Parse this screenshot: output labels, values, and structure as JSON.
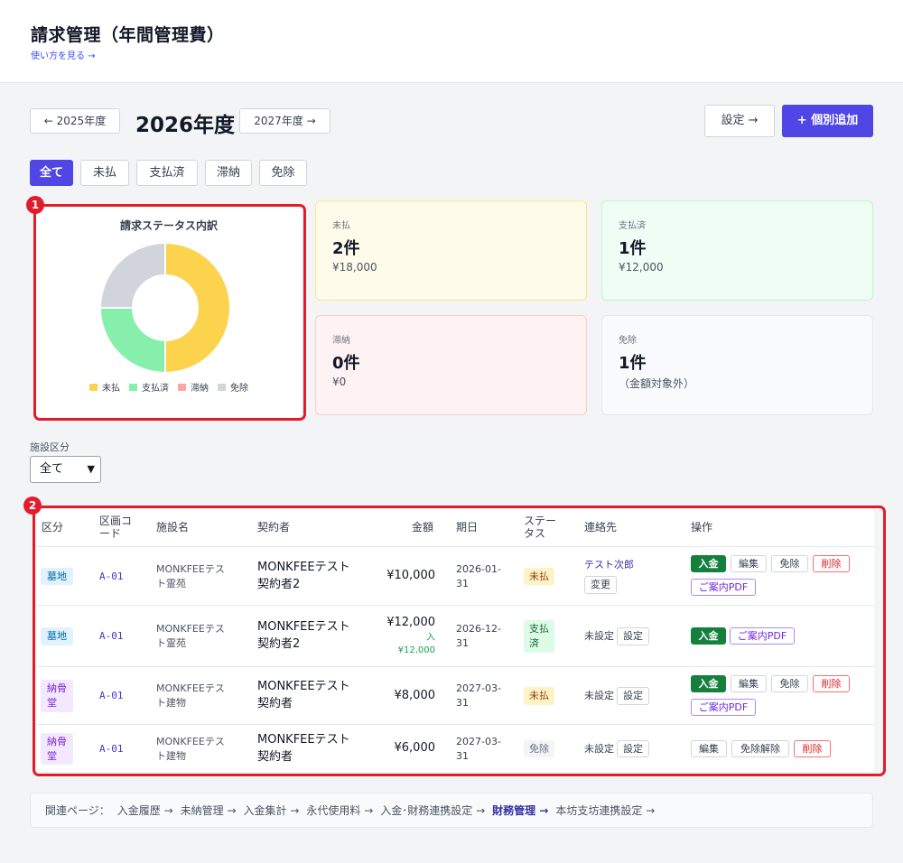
{
  "header": {
    "title": "請求管理（年間管理費）",
    "help_link": "使い方を見る →"
  },
  "year_nav": {
    "prev": "← 2025年度",
    "current": "2026年度",
    "next": "2027年度 →"
  },
  "toolbar": {
    "settings": "設定 →",
    "add": "+ 個別追加"
  },
  "filter_tabs": [
    "全て",
    "未払",
    "支払済",
    "滞納",
    "免除"
  ],
  "chart_data": {
    "type": "pie",
    "title": "請求ステータス内訳",
    "categories": [
      "未払",
      "支払済",
      "滞納",
      "免除"
    ],
    "values": [
      2,
      1,
      0,
      1
    ],
    "colors": [
      "#fcd34d",
      "#86efac",
      "#fca5a5",
      "#d1d5db"
    ],
    "legend_position": "bottom"
  },
  "summary_cards": [
    {
      "label": "未払",
      "count": "2件",
      "amount": "¥18,000"
    },
    {
      "label": "支払済",
      "count": "1件",
      "amount": "¥12,000"
    },
    {
      "label": "滞納",
      "count": "0件",
      "amount": "¥0"
    },
    {
      "label": "免除",
      "count": "1件",
      "amount": "（金額対象外）"
    }
  ],
  "annotations": [
    "1",
    "2"
  ],
  "facility_filter": {
    "label": "施設区分",
    "value": "全て"
  },
  "table": {
    "headers": [
      "区分",
      "区画コード",
      "施設名",
      "契約者",
      "金額",
      "期日",
      "ステータス",
      "連絡先",
      "操作"
    ],
    "rows": [
      {
        "kubun": "墓地",
        "code": "A-01",
        "facility": "MONKFEEテスト霊苑",
        "contractor": "MONKFEEテスト契約者2",
        "amount": "¥10,000",
        "paid_note": "",
        "due": "2026-01-31",
        "status": "未払",
        "contact": "テスト次郎",
        "contact_btn": "変更",
        "actions": [
          "入金",
          "編集",
          "免除",
          "削除",
          "ご案内PDF"
        ]
      },
      {
        "kubun": "墓地",
        "code": "A-01",
        "facility": "MONKFEEテスト霊苑",
        "contractor": "MONKFEEテスト契約者2",
        "amount": "¥12,000",
        "paid_note": "入 ¥12,000",
        "due": "2026-12-31",
        "status": "支払済",
        "contact": "未設定",
        "contact_btn": "設定",
        "actions": [
          "入金",
          "ご案内PDF"
        ]
      },
      {
        "kubun": "納骨堂",
        "code": "A-01",
        "facility": "MONKFEEテスト建物",
        "contractor": "MONKFEEテスト契約者",
        "amount": "¥8,000",
        "paid_note": "",
        "due": "2027-03-31",
        "status": "未払",
        "contact": "未設定",
        "contact_btn": "設定",
        "actions": [
          "入金",
          "編集",
          "免除",
          "削除",
          "ご案内PDF"
        ]
      },
      {
        "kubun": "納骨堂",
        "code": "A-01",
        "facility": "MONKFEEテスト建物",
        "contractor": "MONKFEEテスト契約者",
        "amount": "¥6,000",
        "paid_note": "",
        "due": "2027-03-31",
        "status": "免除",
        "contact": "未設定",
        "contact_btn": "設定",
        "actions": [
          "編集",
          "免除解除",
          "削除"
        ]
      }
    ]
  },
  "related": {
    "label": "関連ページ：",
    "links": [
      "入金履歴 →",
      "未納管理 →",
      "入金集計 →",
      "永代使用料 →",
      "入金･財務連携設定 →",
      "財務管理 →",
      "本坊支坊連携設定 →"
    ]
  }
}
